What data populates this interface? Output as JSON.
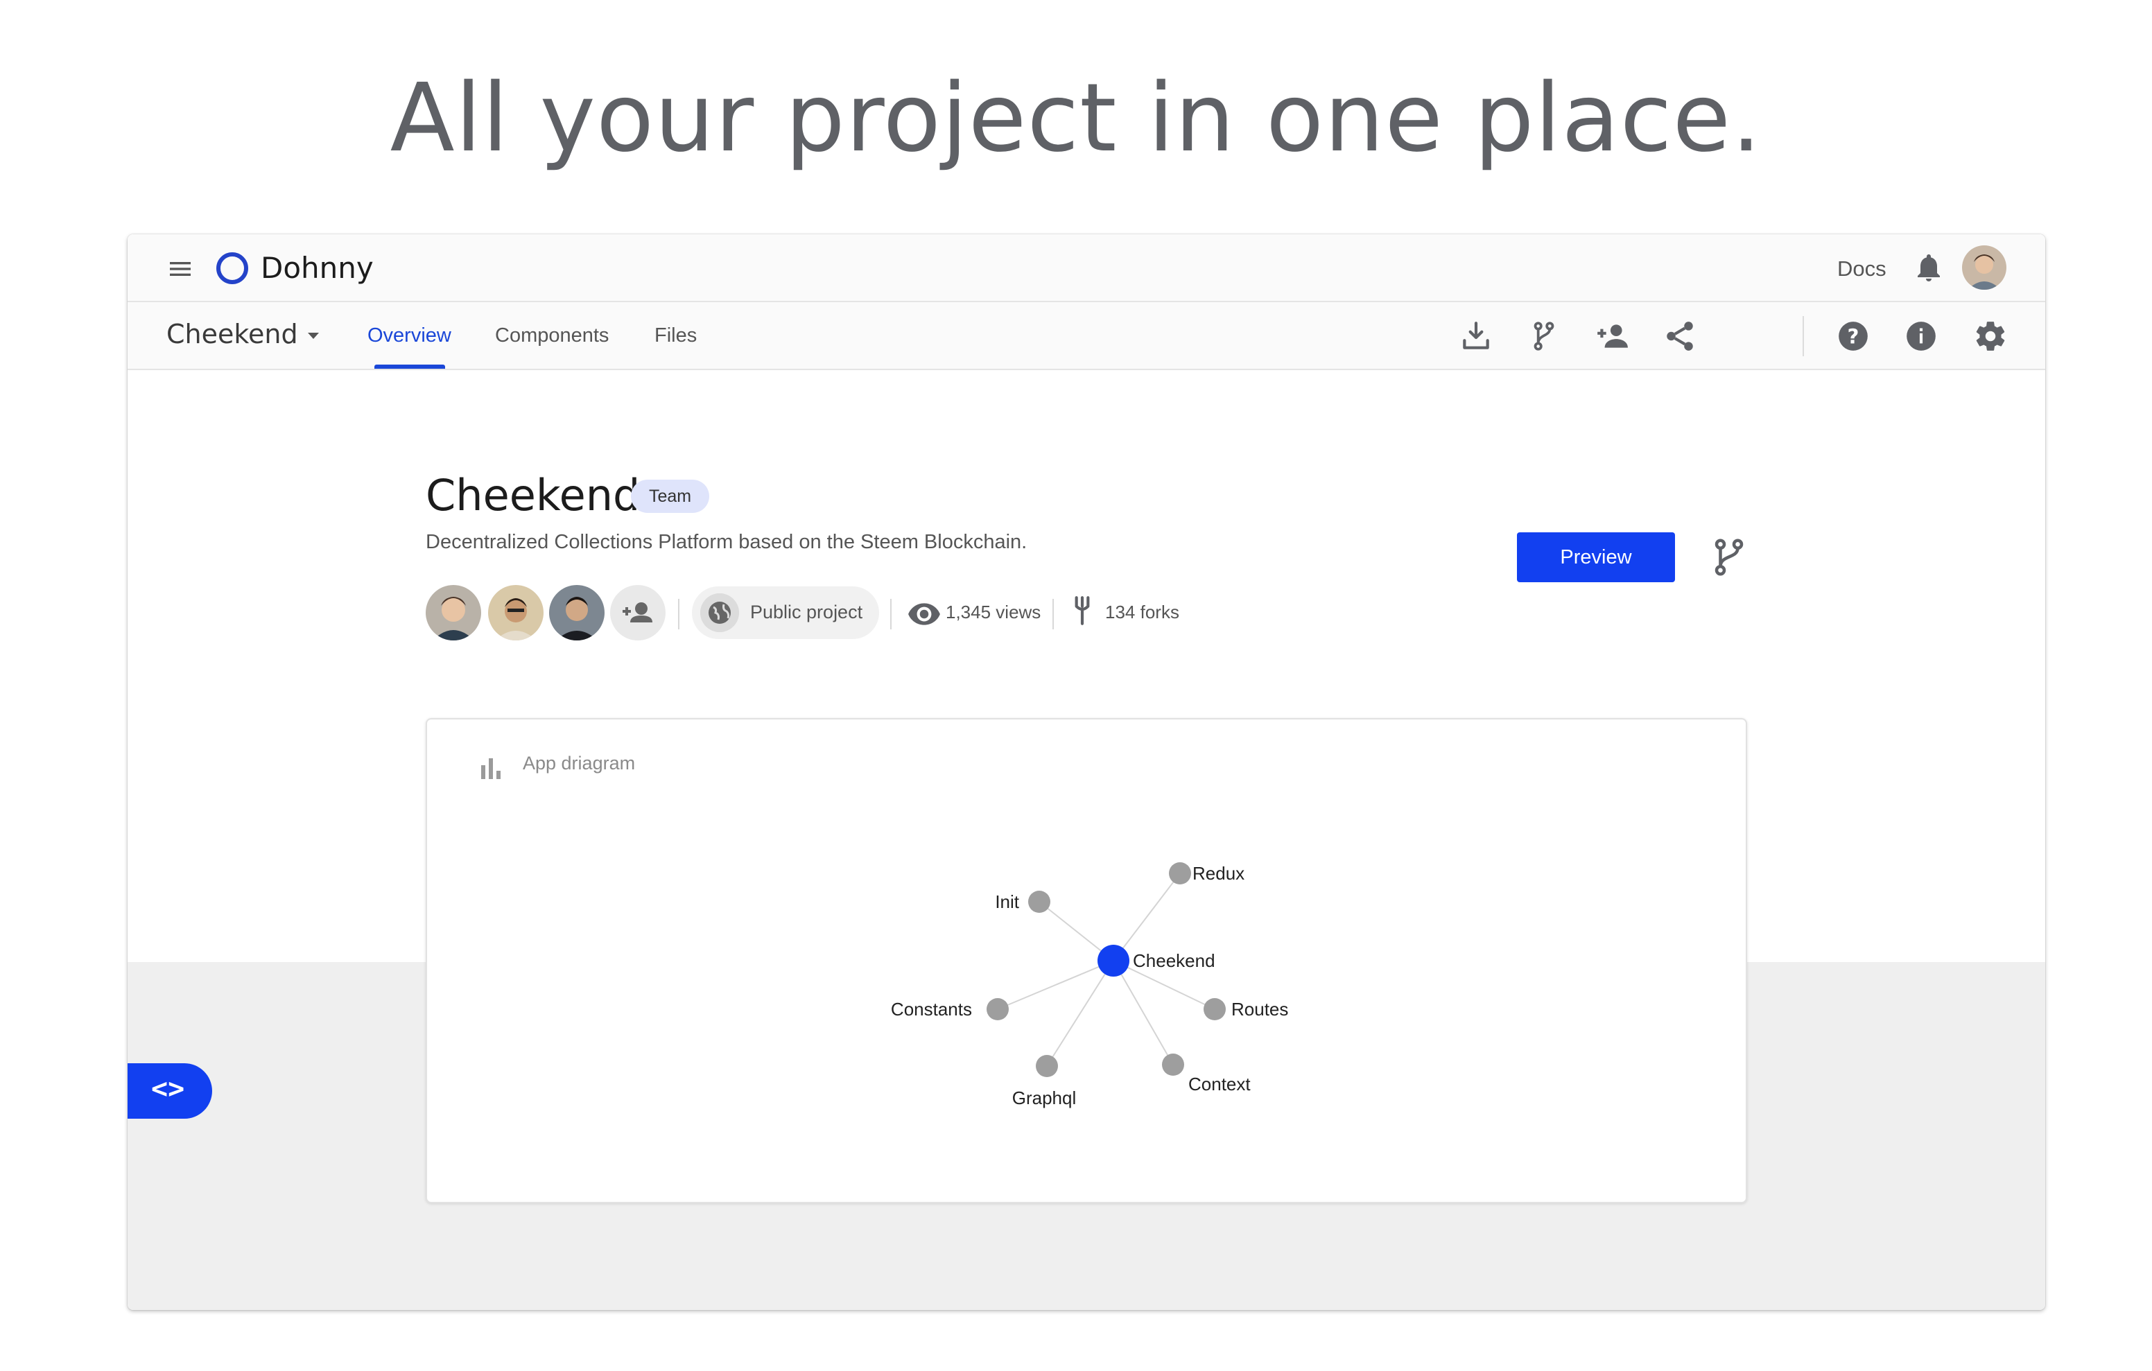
{
  "hero": {
    "title": "All your project in one place."
  },
  "topbar": {
    "brand": "Dohnny",
    "docs_label": "Docs"
  },
  "subbar": {
    "project_name": "Cheekend",
    "tabs": [
      {
        "label": "Overview",
        "active": true
      },
      {
        "label": "Components",
        "active": false
      },
      {
        "label": "Files",
        "active": false
      }
    ],
    "tools": [
      "download-icon",
      "branch-icon",
      "add-person-icon",
      "share-icon",
      "help-icon",
      "info-icon",
      "settings-icon"
    ]
  },
  "project": {
    "title": "Cheekend",
    "badge": "Team",
    "description": "Decentralized Collections Platform based on the Steem Blockchain.",
    "visibility": "Public project",
    "views": "1,345 views",
    "forks": "134 forks",
    "preview_label": "Preview",
    "members": [
      "member-1",
      "member-2",
      "member-3"
    ]
  },
  "diagram": {
    "title": "App driagram",
    "center": "Cheekend",
    "nodes": [
      "Redux",
      "Init",
      "Constants",
      "Routes",
      "Graphql",
      "Context"
    ]
  },
  "colors": {
    "accent": "#1240f0",
    "node_gray": "#9e9e9e",
    "center_node": "#1240f0"
  }
}
